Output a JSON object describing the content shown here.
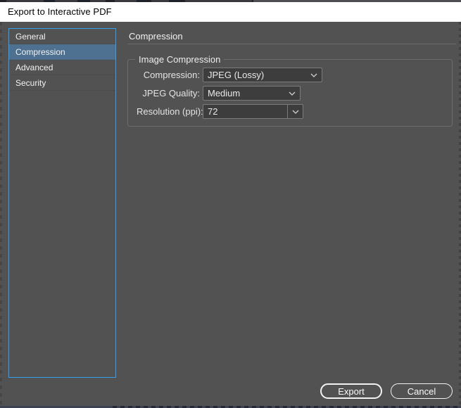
{
  "window": {
    "title": "Export to Interactive PDF"
  },
  "sidebar": {
    "items": [
      {
        "label": "General",
        "selected": false
      },
      {
        "label": "Compression",
        "selected": true
      },
      {
        "label": "Advanced",
        "selected": false
      },
      {
        "label": "Security",
        "selected": false
      }
    ]
  },
  "panel": {
    "heading": "Compression",
    "group": {
      "legend": "Image Compression",
      "fields": [
        {
          "label": "Compression:",
          "value": "JPEG (Lossy)",
          "control": "dropdown"
        },
        {
          "label": "JPEG Quality:",
          "value": "Medium",
          "control": "dropdown"
        },
        {
          "label": "Resolution (ppi):",
          "value": "72",
          "control": "combobox"
        }
      ]
    }
  },
  "footer": {
    "export_label": "Export",
    "cancel_label": "Cancel"
  },
  "icons": {
    "dropdown_chevron": "chevron-down"
  },
  "colors": {
    "accent_blue": "#36a0f0",
    "selection_blue": "#4e7191",
    "dialog_bg": "#525252",
    "titlebar_bg": "#ffffff",
    "titlebar_text": "#000000",
    "control_bg": "#3d3d3d",
    "control_border": "#7b7b7b",
    "text_light": "#e9e9e9",
    "button_border": "#f2f2f2"
  }
}
